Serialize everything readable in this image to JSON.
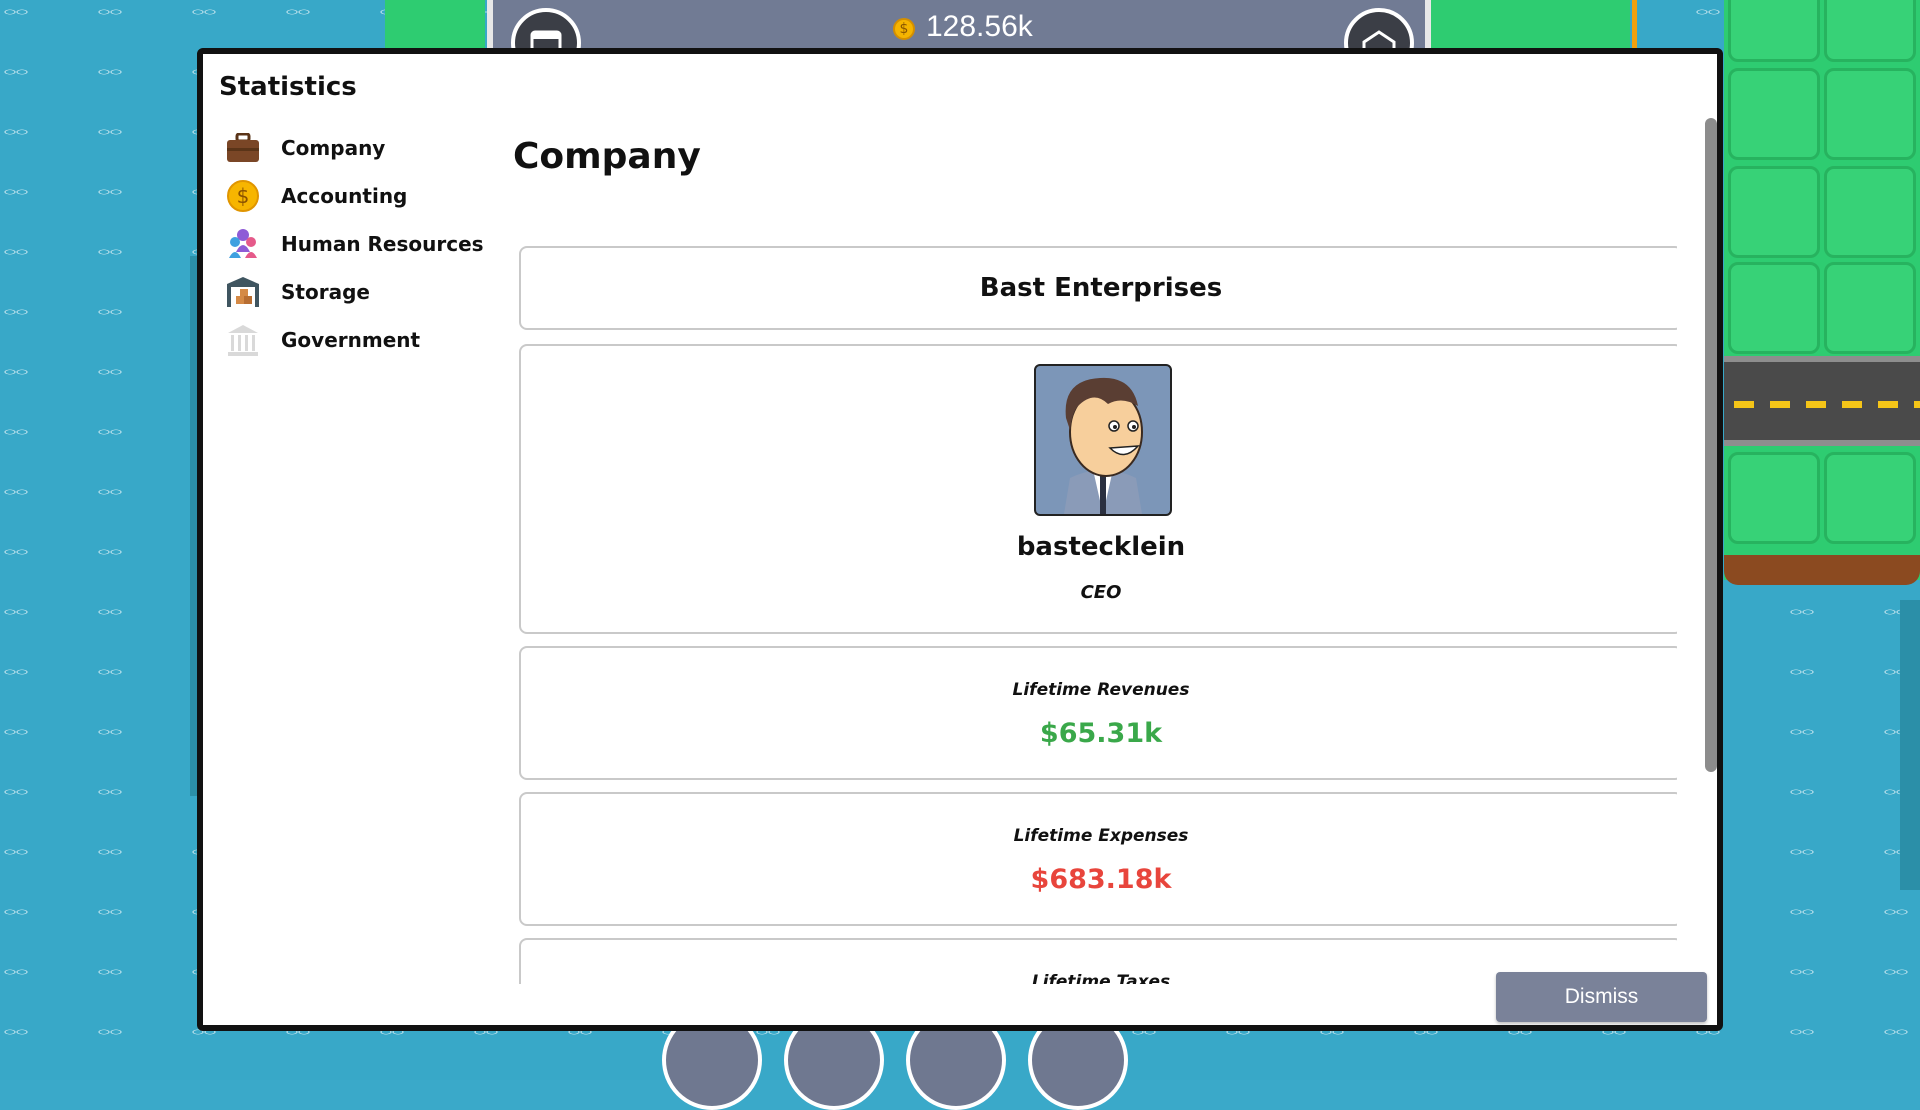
{
  "hud": {
    "money": "128.56k",
    "coin_icon": "$"
  },
  "modal": {
    "title": "Statistics",
    "nav": [
      {
        "label": "Company",
        "icon": "briefcase-icon"
      },
      {
        "label": "Accounting",
        "icon": "dollar-coin-icon"
      },
      {
        "label": "Human Resources",
        "icon": "people-icon"
      },
      {
        "label": "Storage",
        "icon": "warehouse-icon"
      },
      {
        "label": "Government",
        "icon": "government-building-icon"
      }
    ],
    "content": {
      "heading": "Company",
      "company_name": "Bast Enterprises",
      "ceo": {
        "username": "bastecklein",
        "role": "CEO"
      },
      "stats": [
        {
          "label": "Lifetime Revenues",
          "value": "$65.31k",
          "color": "#3aa84a"
        },
        {
          "label": "Lifetime Expenses",
          "value": "$683.18k",
          "color": "#e8453c"
        },
        {
          "label": "Lifetime Taxes",
          "value": "",
          "color": "#111111"
        }
      ]
    },
    "dismiss_label": "Dismiss"
  }
}
